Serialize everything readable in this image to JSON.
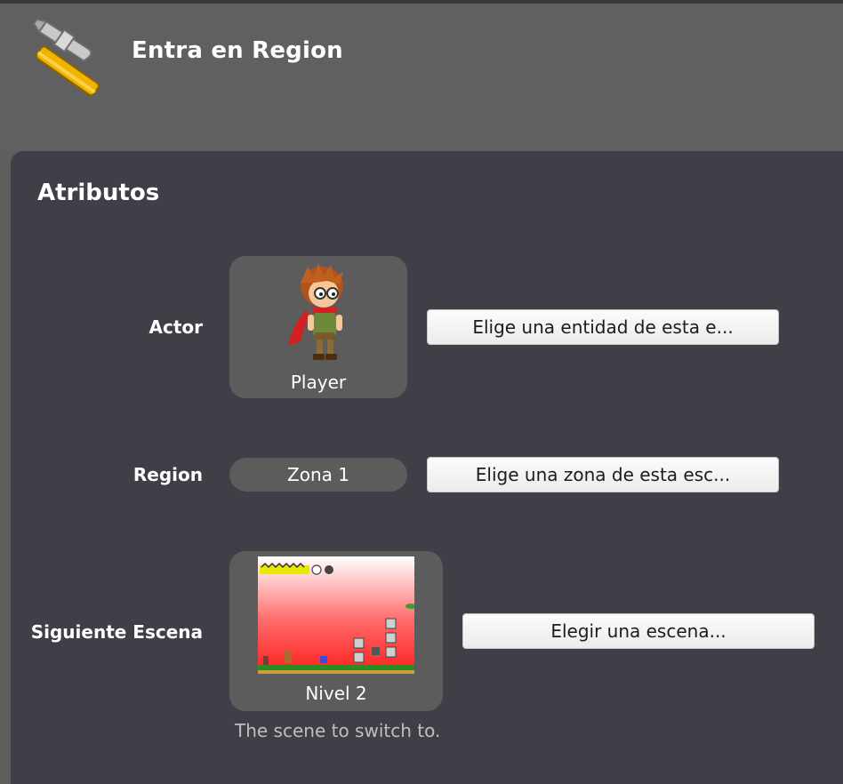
{
  "header": {
    "icon": "hammer-icon",
    "title": "Entra en Region"
  },
  "attributes": {
    "section_title": "Atributos",
    "actor": {
      "label": "Actor",
      "thumbnail_caption": "Player",
      "button_label": "Elige una entidad de esta e..."
    },
    "region": {
      "label": "Region",
      "value": "Zona 1",
      "button_label": "Elige una zona de esta esc..."
    },
    "next_scene": {
      "label": "Siguiente Escena",
      "thumbnail_caption": "Nivel 2",
      "button_label": "Elegir una escena...",
      "hint": "The scene to switch to."
    }
  },
  "colors": {
    "header_bg": "#606060",
    "panel_bg": "#3f3f48",
    "card_bg": "#5c5c5c",
    "scene_sky_top": "#ffffff",
    "scene_sky_bottom": "#ff2020",
    "ground": "#2e8b22"
  }
}
